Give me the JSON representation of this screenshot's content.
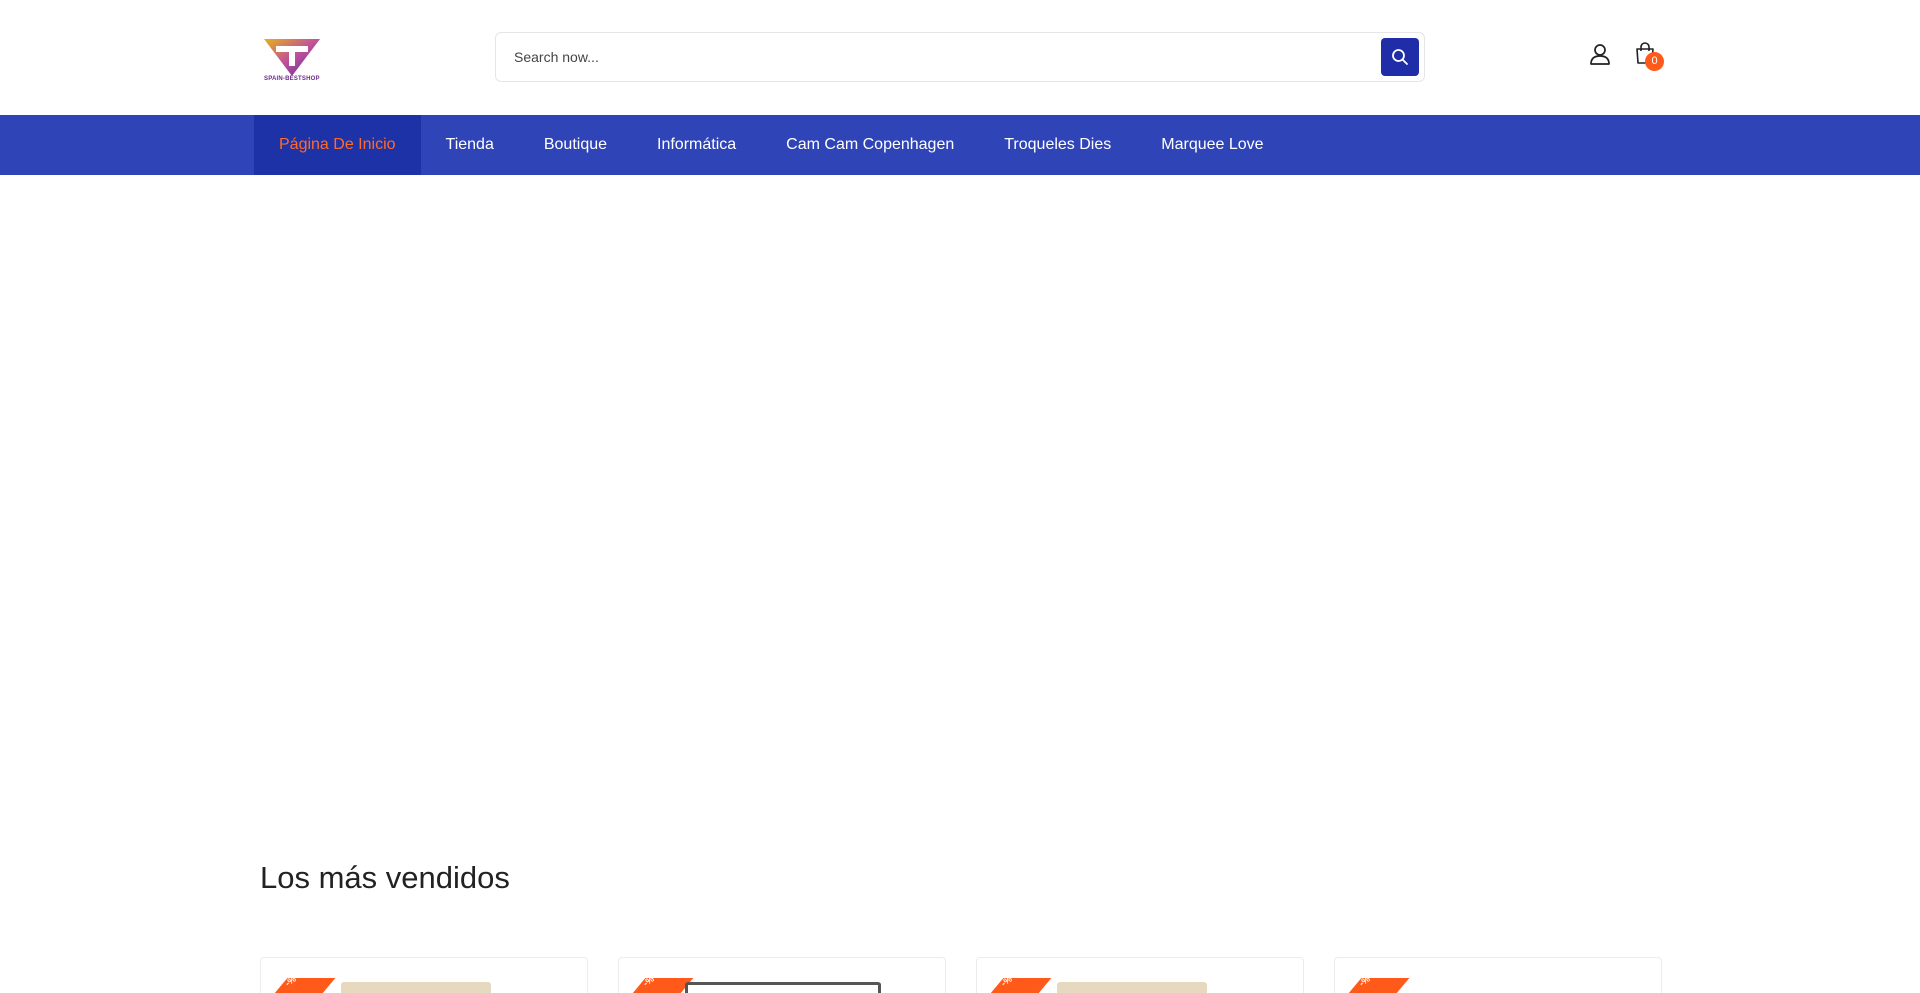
{
  "header": {
    "logo_text": "SPAIN-BESTSHOP",
    "search_placeholder": "Search now...",
    "cart_count": "0"
  },
  "nav": {
    "items": [
      {
        "label": "Página De Inicio",
        "active": true
      },
      {
        "label": "Tienda"
      },
      {
        "label": "Boutique"
      },
      {
        "label": "Informática"
      },
      {
        "label": "Cam Cam Copenhagen"
      },
      {
        "label": "Troqueles Dies"
      },
      {
        "label": "Marquee Love"
      }
    ]
  },
  "bestsellers": {
    "title": "Los más vendidos",
    "products": [
      {
        "badge": "-%"
      },
      {
        "badge": "-%"
      },
      {
        "badge": "-%"
      },
      {
        "badge": "-%"
      }
    ]
  },
  "colors": {
    "nav_bg": "#2f44b6",
    "nav_active_bg": "#1e32a8",
    "accent": "#ff5a1a",
    "search_button": "#1f2ea8"
  }
}
